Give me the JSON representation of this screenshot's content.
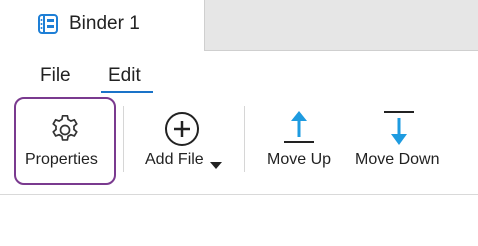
{
  "tab": {
    "title": "Binder 1",
    "icon": "binder-icon"
  },
  "menu": {
    "file_label": "File",
    "edit_label": "Edit",
    "active": "Edit"
  },
  "toolbar": {
    "properties_label": "Properties",
    "add_file_label": "Add File",
    "move_up_label": "Move Up",
    "move_down_label": "Move Down"
  },
  "colors": {
    "accent": "#1a73c8",
    "arrow_blue": "#1e9be0",
    "focus_outline": "#7a3a8f"
  }
}
